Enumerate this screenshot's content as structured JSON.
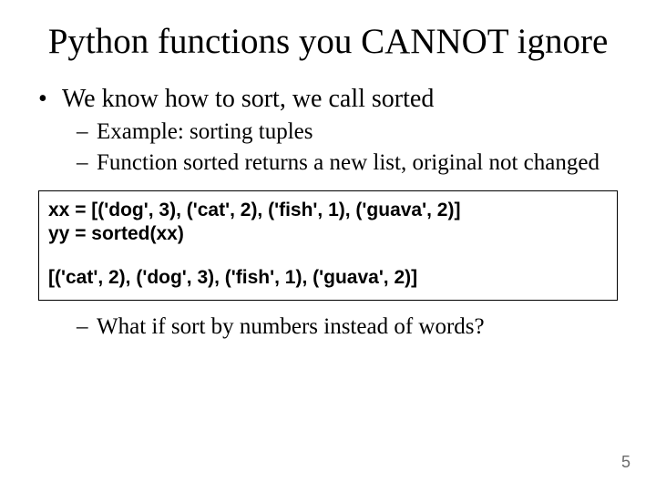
{
  "title": "Python functions you CANNOT ignore",
  "bullets": {
    "l1": "We know how to sort, we call sorted",
    "sub1": "Example: sorting tuples",
    "sub2": "Function sorted returns a new list, original not changed",
    "sub3": "What if sort by numbers instead of words?"
  },
  "code": {
    "line1": "xx = [('dog', 3), ('cat', 2), ('fish', 1),  ('guava', 2)]",
    "line2": "yy = sorted(xx)",
    "output": "[('cat', 2), ('dog', 3), ('fish', 1), ('guava', 2)]"
  },
  "page_number": "5"
}
